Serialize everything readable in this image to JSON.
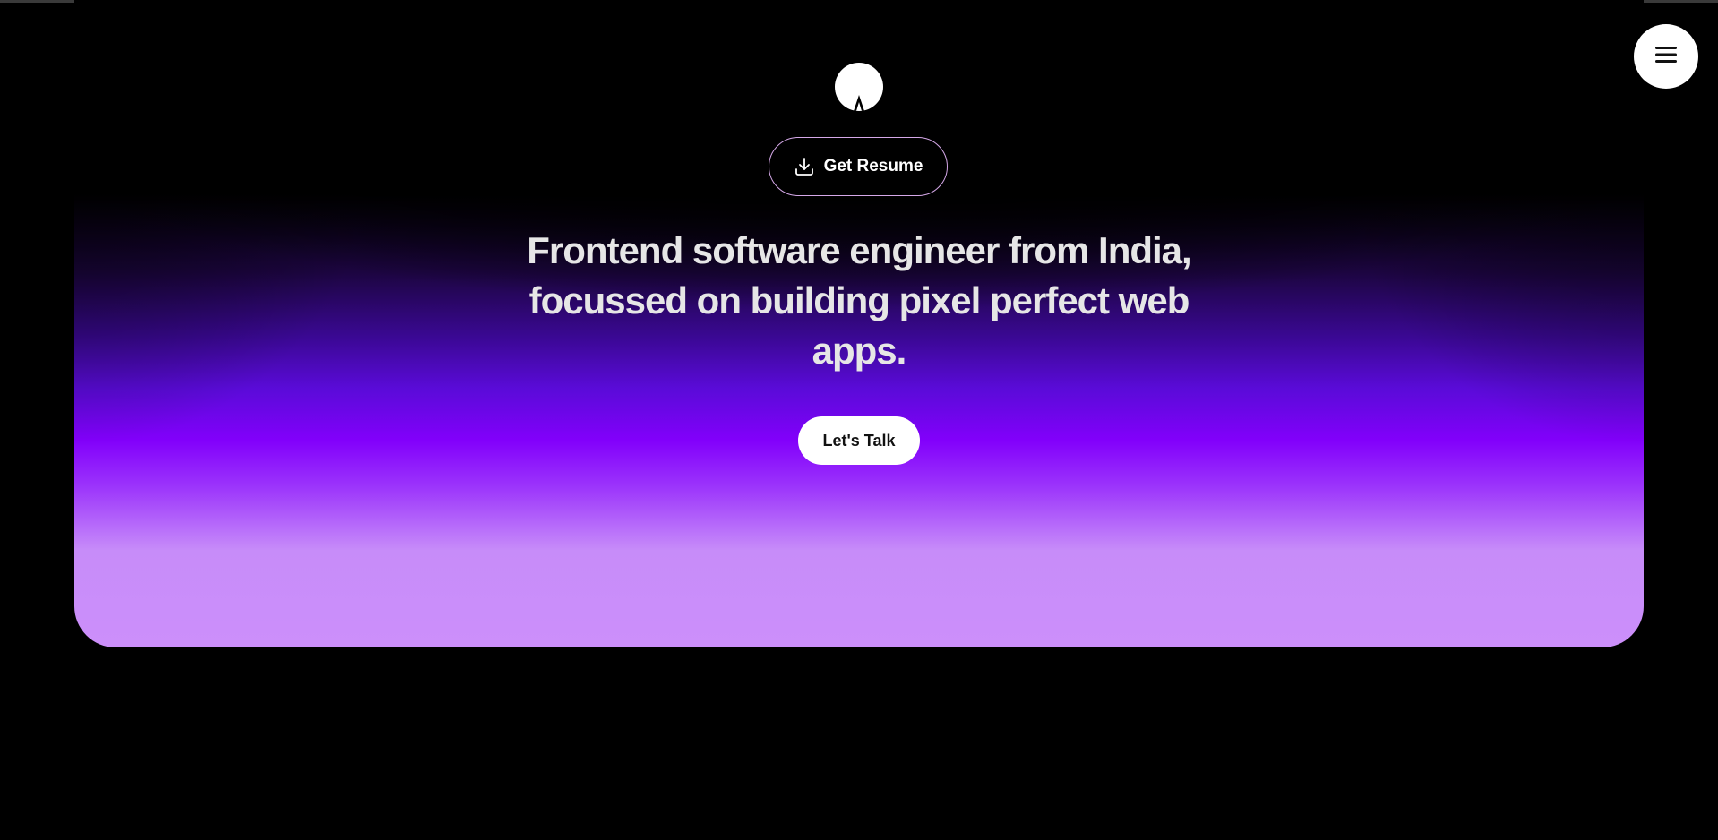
{
  "hero": {
    "resume_label": "Get Resume",
    "headline": "Frontend software engineer from India, focussed on building pixel perfect web apps.",
    "cta_label": "Let's Talk"
  },
  "icons": {
    "logo": "logo-icon",
    "download": "download-icon",
    "menu": "hamburger-menu-icon"
  },
  "colors": {
    "background": "#000000",
    "accent_purple": "#8200fb",
    "light_purple": "#cc8ffa",
    "button_border": "#d5a8e8"
  }
}
